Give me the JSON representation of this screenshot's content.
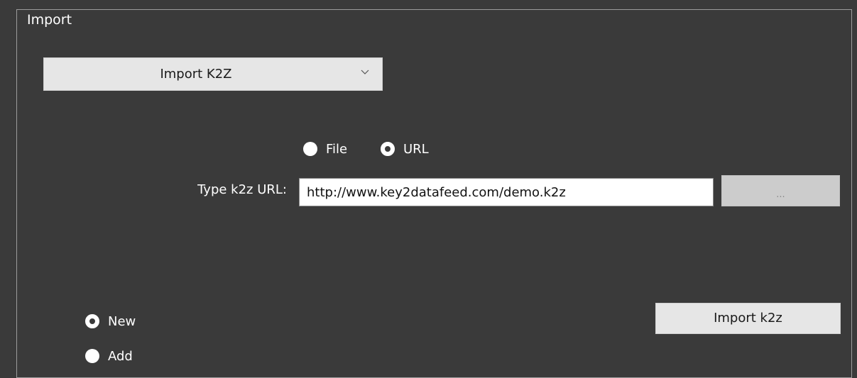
{
  "group": {
    "title": "Import"
  },
  "dropdown": {
    "selected": "Import K2Z",
    "chevron_icon": "chevron-down-icon"
  },
  "source": {
    "file_label": "File",
    "url_label": "URL",
    "selected": "URL"
  },
  "url_field": {
    "label": "Type k2z URL:",
    "value": "http://www.key2datafeed.com/demo.k2z"
  },
  "browse_button": {
    "label": "..."
  },
  "mode": {
    "new_label": "New",
    "add_label": "Add",
    "selected": "New"
  },
  "import_button": {
    "label": "Import k2z"
  },
  "colors": {
    "background": "#3a3a3a",
    "control_light": "#e6e6e6",
    "text_light": "#ffffff"
  }
}
